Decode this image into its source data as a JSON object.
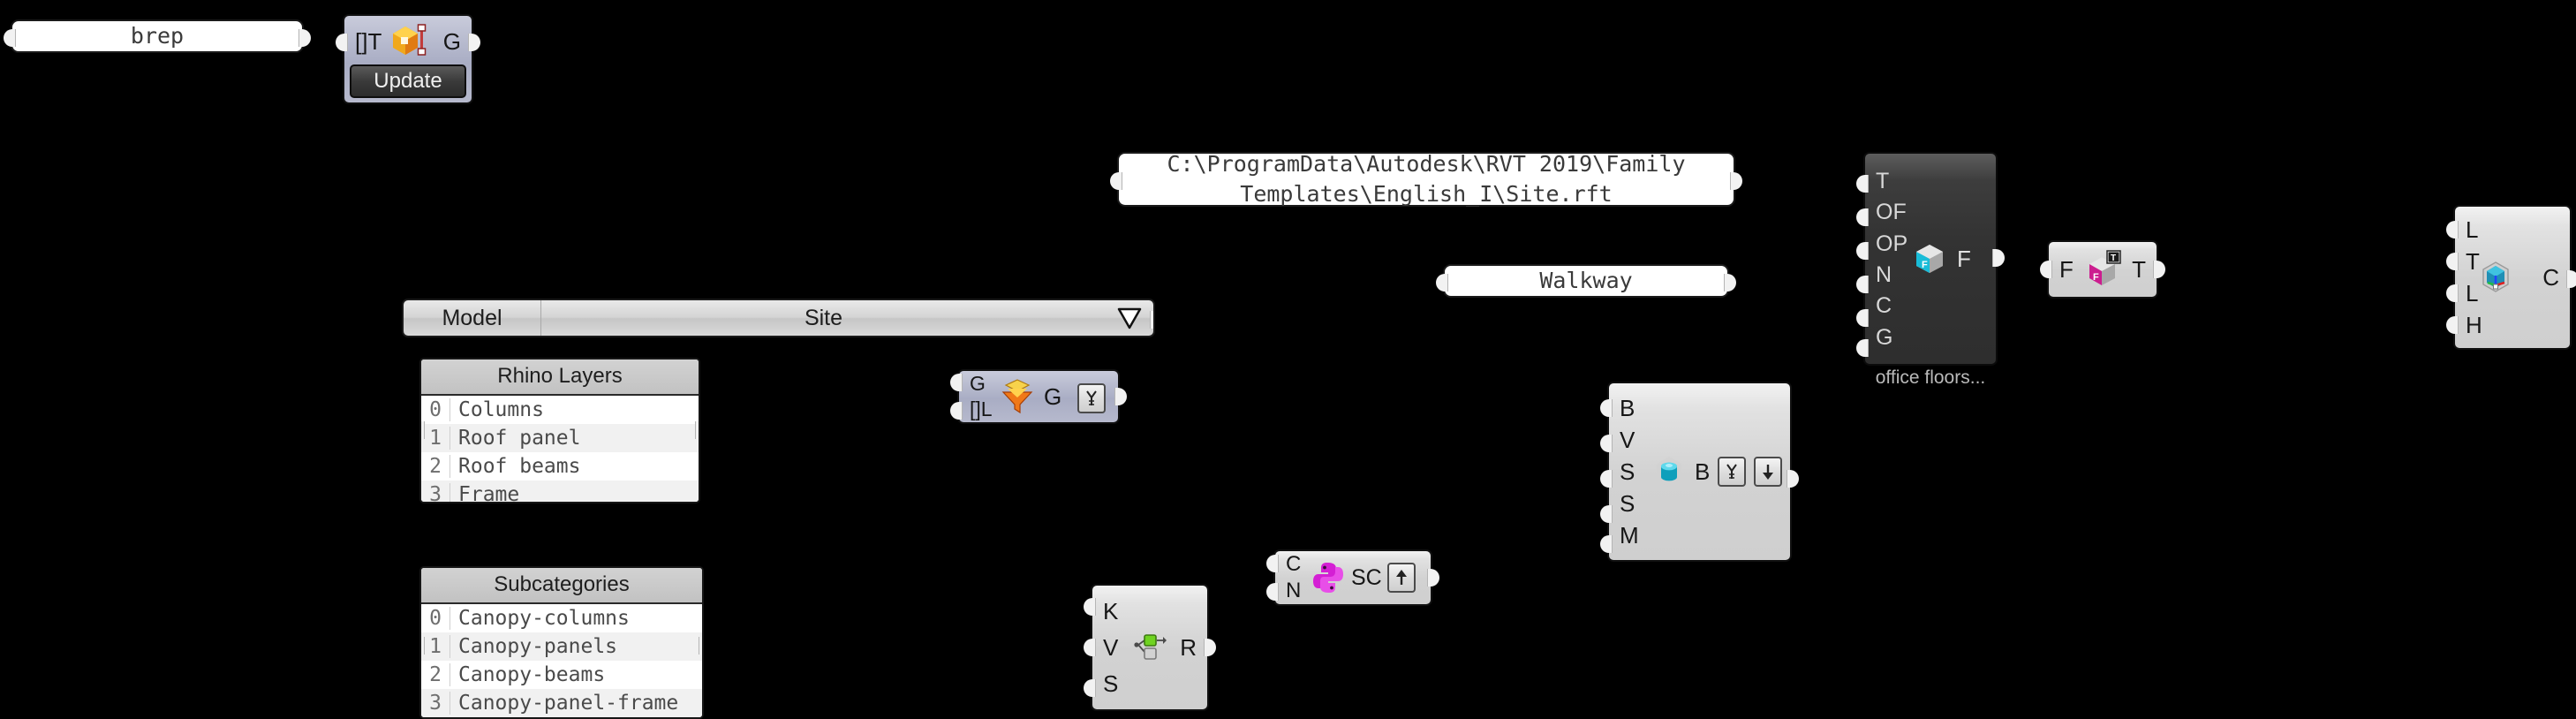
{
  "canvas": {
    "background": "#000000",
    "app": "Grasshopper canvas"
  },
  "nodes": {
    "brep_panel": {
      "kind": "panel",
      "text": "brep"
    },
    "geometry_pipeline": {
      "kind": "component",
      "inputs": [
        "[]T"
      ],
      "outputs": [
        "G"
      ],
      "icon": "orange-cube-icon",
      "button_label": "Update"
    },
    "path_panel": {
      "kind": "panel",
      "text": "C:\\ProgramData\\Autodesk\\RVT 2019\\Family\nTemplates\\English_I\\Site.rft"
    },
    "walkway_panel": {
      "kind": "panel",
      "text": "Walkway"
    },
    "value_list": {
      "kind": "value-list",
      "name": "Model",
      "selected": "Site",
      "arrow": "triangle-down-icon"
    },
    "rhino_layers": {
      "kind": "list-panel",
      "title": "Rhino Layers",
      "rows": [
        {
          "index": "0",
          "value": "Columns"
        },
        {
          "index": "1",
          "value": "Roof panel"
        },
        {
          "index": "2",
          "value": "Roof beams"
        },
        {
          "index": "3",
          "value": "Frame"
        }
      ]
    },
    "subcategories": {
      "kind": "list-panel",
      "title": "Subcategories",
      "rows": [
        {
          "index": "0",
          "value": "Canopy-columns"
        },
        {
          "index": "1",
          "value": "Canopy-panels"
        },
        {
          "index": "2",
          "value": "Canopy-beams"
        },
        {
          "index": "3",
          "value": "Canopy-panel-frame"
        }
      ]
    },
    "geometry_filter": {
      "kind": "component",
      "inputs": [
        "G",
        "[]L"
      ],
      "outputs": [
        "G"
      ],
      "icon": "orange-funnel-icon",
      "mini_buttons": [
        "graft-icon"
      ]
    },
    "office_floors": {
      "kind": "component",
      "inputs": [
        "T",
        "OF",
        "OP",
        "N",
        "C",
        "G"
      ],
      "outputs": [
        "F"
      ],
      "icon": "cyan-f-cube-icon",
      "caption": "office floors..."
    },
    "family_to_type": {
      "kind": "component",
      "inputs": [
        "F"
      ],
      "outputs": [
        "T"
      ],
      "icon": "magenta-f-cube-icon",
      "badge": "T"
    },
    "cylinder_comp": {
      "kind": "component",
      "inputs": [
        "B",
        "V",
        "S",
        "S",
        "M"
      ],
      "outputs": [
        "B"
      ],
      "icon": "teal-cylinder-icon",
      "mini_buttons": [
        "graft-icon",
        "flatten-icon"
      ]
    },
    "python_script": {
      "kind": "component",
      "inputs": [
        "C",
        "N"
      ],
      "outputs": [
        "SC"
      ],
      "icon": "python-icon",
      "mini_buttons": [
        "up-arrow-icon"
      ]
    },
    "member_pick": {
      "kind": "component",
      "inputs": [
        "K",
        "V",
        "S"
      ],
      "outputs": [
        "R"
      ],
      "icon": "green-pick-icon"
    },
    "construct_plane": {
      "kind": "component",
      "inputs": [
        "L",
        "T",
        "L",
        "H"
      ],
      "outputs": [
        "C"
      ],
      "icon": "teal-hex-axis-icon"
    }
  },
  "colors": {
    "canvas_bg": "#000000",
    "panel_bg": "#ffffff",
    "component_bg": "#d4d4d4",
    "component_bluish": "#aeb1c6",
    "component_dark": "#333333",
    "port": "#f2f2f2"
  }
}
